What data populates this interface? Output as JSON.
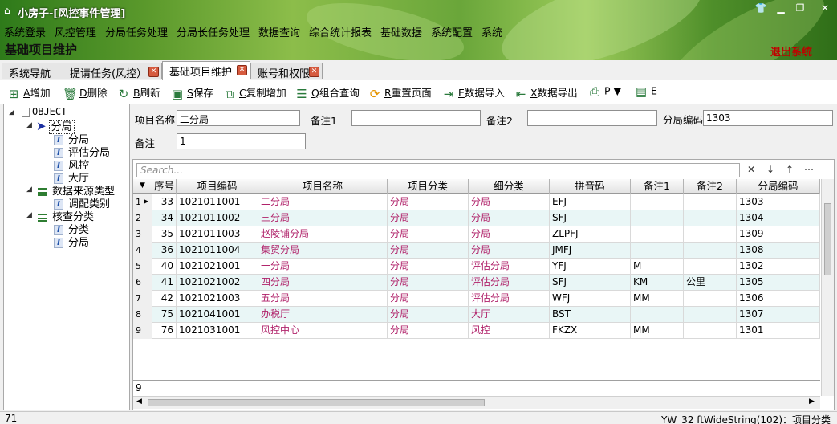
{
  "window": {
    "title": "小房子-[风控事件管理]",
    "app_icon": "home-icon",
    "controls": [
      "shirt-icon",
      "minimize-icon",
      "restore-icon",
      "close-icon"
    ]
  },
  "menu": [
    "系统登录",
    "风控管理",
    "分局任务处理",
    "分局长任务处理",
    "数据查询",
    "综合统计报表",
    "基础数据",
    "系统配置",
    "系统"
  ],
  "page_heading": "基础项目维护",
  "logout_label": "退出系统",
  "tabs": [
    {
      "label": "系统导航"
    },
    {
      "label": "提请任务(风控）"
    },
    {
      "label": "基础项目维护"
    },
    {
      "label": "账号和权限"
    }
  ],
  "toolbar": {
    "add": {
      "key": "A",
      "label": "增加"
    },
    "delete": {
      "key": "D",
      "label": "删除"
    },
    "refresh": {
      "key": "B",
      "label": "刷新"
    },
    "save": {
      "key": "S",
      "label": "保存"
    },
    "copy_add": {
      "key": "C",
      "label": "复制增加"
    },
    "query": {
      "key": "Q",
      "label": "组合查询"
    },
    "reset": {
      "key": "R",
      "label": "重置页面"
    },
    "import": {
      "key": "E",
      "label": "数据导入"
    },
    "export": {
      "key": "X",
      "label": "数据导出"
    },
    "print": {
      "key": "P",
      "label": "▼"
    },
    "excel": {
      "key": "E",
      "label": ""
    }
  },
  "tree": {
    "root": "OBJECT",
    "nodes": [
      {
        "label": "分局",
        "children": [
          "分局",
          "评估分局",
          "风控",
          "大厅"
        ]
      },
      {
        "label": "数据来源类型",
        "children": [
          "调配类别"
        ]
      },
      {
        "label": "核查分类",
        "children": [
          "分类",
          "分局"
        ]
      }
    ]
  },
  "form": {
    "name_label": "项目名称",
    "name_value": "二分局",
    "note1_label": "备注1",
    "note1_value": "",
    "note2_label": "备注2",
    "note2_value": "",
    "code_label": "分局编码",
    "code_value": "1303",
    "note_label": "备注",
    "note_value": "1"
  },
  "grid": {
    "search_placeholder": "Search...",
    "columns": [
      "序号",
      "项目编码",
      "项目名称",
      "项目分类",
      "细分类",
      "拼音码",
      "备注1",
      "备注2",
      "分局编码"
    ],
    "rows": [
      {
        "rn": "1",
        "seq": "33",
        "code": "1021011001",
        "name": "二分局",
        "cat": "分局",
        "sub": "分局",
        "py": "EFJ",
        "n1": "",
        "n2": "",
        "bc": "1303"
      },
      {
        "rn": "2",
        "seq": "34",
        "code": "1021011002",
        "name": "三分局",
        "cat": "分局",
        "sub": "分局",
        "py": "SFJ",
        "n1": "",
        "n2": "",
        "bc": "1304"
      },
      {
        "rn": "3",
        "seq": "35",
        "code": "1021011003",
        "name": "赵陵铺分局",
        "cat": "分局",
        "sub": "分局",
        "py": "ZLPFJ",
        "n1": "",
        "n2": "",
        "bc": "1309"
      },
      {
        "rn": "4",
        "seq": "36",
        "code": "1021011004",
        "name": "集贸分局",
        "cat": "分局",
        "sub": "分局",
        "py": "JMFJ",
        "n1": "",
        "n2": "",
        "bc": "1308"
      },
      {
        "rn": "5",
        "seq": "40",
        "code": "1021021001",
        "name": "一分局",
        "cat": "分局",
        "sub": "评估分局",
        "py": "YFJ",
        "n1": "M",
        "n2": "",
        "bc": "1302"
      },
      {
        "rn": "6",
        "seq": "41",
        "code": "1021021002",
        "name": "四分局",
        "cat": "分局",
        "sub": "评估分局",
        "py": "SFJ",
        "n1": "KM",
        "n2": "公里",
        "bc": "1305"
      },
      {
        "rn": "7",
        "seq": "42",
        "code": "1021021003",
        "name": "五分局",
        "cat": "分局",
        "sub": "评估分局",
        "py": "WFJ",
        "n1": "MM",
        "n2": "",
        "bc": "1306"
      },
      {
        "rn": "8",
        "seq": "75",
        "code": "1021041001",
        "name": "办税厅",
        "cat": "分局",
        "sub": "大厅",
        "py": "BST",
        "n1": "",
        "n2": "",
        "bc": "1307"
      },
      {
        "rn": "9",
        "seq": "76",
        "code": "1021031001",
        "name": "风控中心",
        "cat": "分局",
        "sub": "风控",
        "py": "FKZX",
        "n1": "MM",
        "n2": "",
        "bc": "1301"
      }
    ],
    "footer_count": "9"
  },
  "status": {
    "left": "71",
    "right": "YW_32 ftWideString(102)：项目分类"
  }
}
